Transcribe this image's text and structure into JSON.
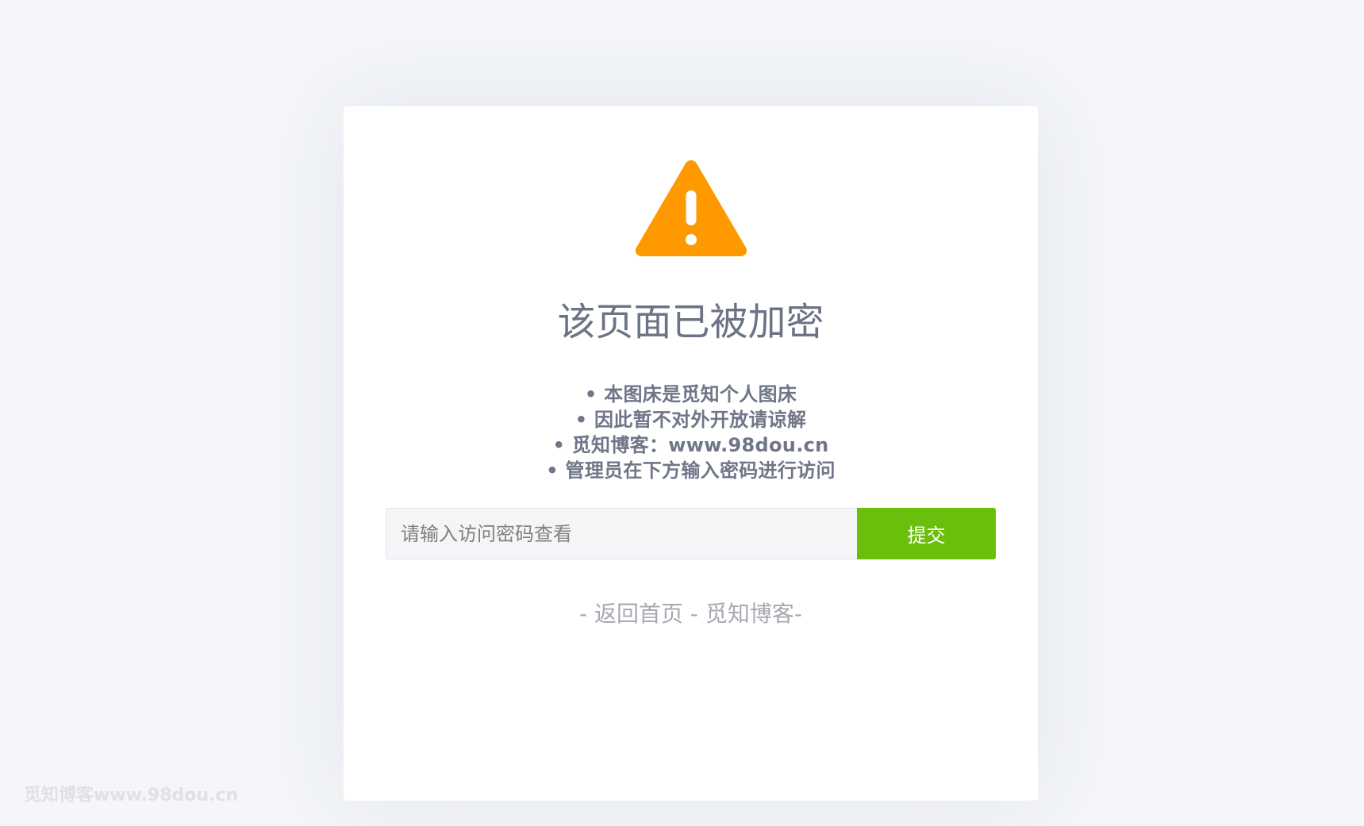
{
  "page": {
    "background": "#f4f6f9"
  },
  "card": {
    "icon": "warning-triangle-icon",
    "icon_color": "#ff9900",
    "title": "该页面已被加密",
    "notes": [
      "• 本图床是觅知个人图床",
      "• 因此暂不对外开放请谅解",
      "• 觅知博客：www.98dou.cn",
      "• 管理员在下方输入密码进行访问"
    ]
  },
  "form": {
    "password_placeholder": "请输入访问密码查看",
    "password_value": "",
    "submit_label": "提交",
    "submit_color": "#6abf0b"
  },
  "footer_links": {
    "prefix": "- ",
    "home_label": "返回首页",
    "separator": " - ",
    "blog_label": "觅知博客",
    "suffix": "-"
  },
  "watermark": "觅知博客www.98dou.cn"
}
